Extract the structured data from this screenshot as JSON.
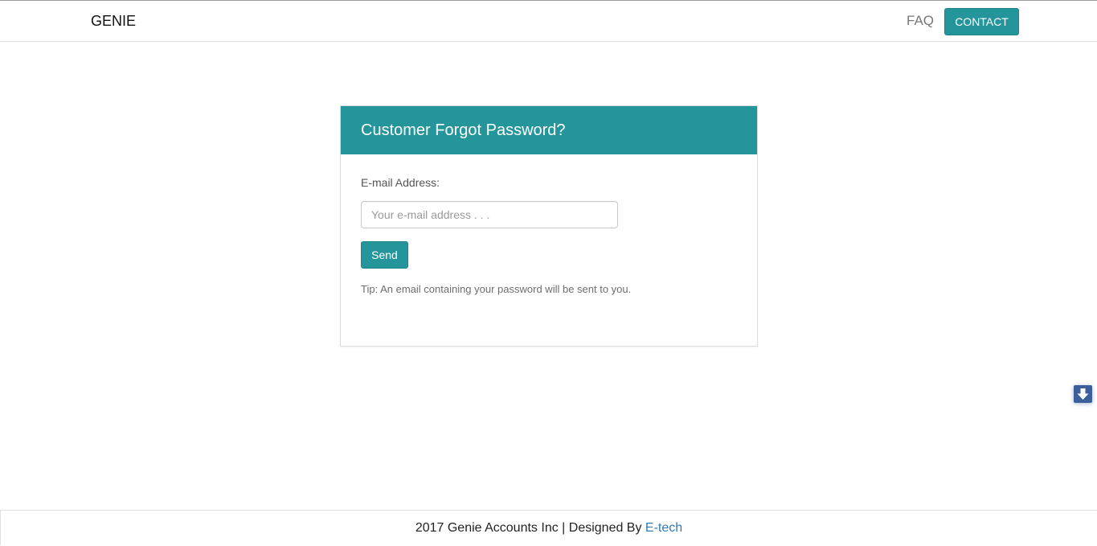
{
  "navbar": {
    "brand": "GENIE",
    "faq_label": "FAQ",
    "contact_label": "CONTACT"
  },
  "colors": {
    "accent": "#24969b",
    "link": "#337ab7",
    "scroll_widget": "#3c5f9c"
  },
  "form": {
    "title": "Customer Forgot Password?",
    "email_label": "E-mail Address:",
    "email_value": "",
    "email_placeholder": "Your e-mail address . . .",
    "send_label": "Send",
    "tip": "Tip: An email containing your password will be sent to you."
  },
  "scroll_widget": {
    "icon": "arrow-down-icon"
  },
  "footer": {
    "text": "2017 Genie Accounts Inc | Designed By ",
    "link_label": "E-tech"
  }
}
